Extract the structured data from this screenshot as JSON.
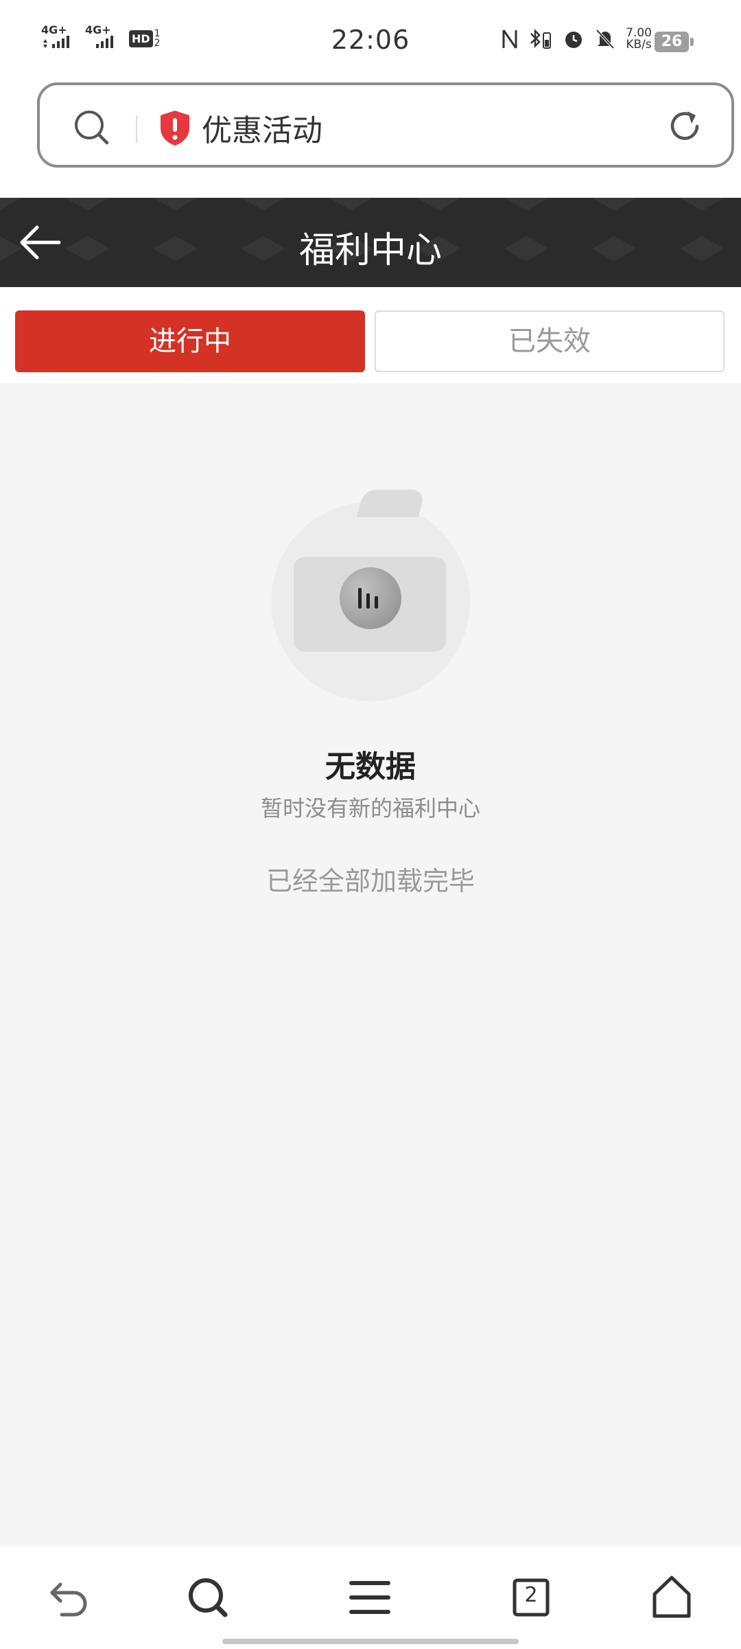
{
  "status_bar": {
    "time": "22:06",
    "signal1": "4G+",
    "signal2": "4G+",
    "hd": "HD",
    "net_speed_value": "7.00",
    "net_speed_unit": "KB/s",
    "battery": "26"
  },
  "address_bar": {
    "title": "优惠活动"
  },
  "header": {
    "title": "福利中心"
  },
  "tabs": [
    {
      "label": "进行中",
      "active": true
    },
    {
      "label": "已失效",
      "active": false
    }
  ],
  "empty_state": {
    "title": "无数据",
    "subtitle": "暂时没有新的福利中心"
  },
  "list_footer": {
    "text": "已经全部加载完毕"
  },
  "bottom_nav": {
    "tab_count": "2",
    "items": [
      "back-icon",
      "search-icon",
      "menu-icon",
      "tabs-icon",
      "home-icon"
    ]
  },
  "colors": {
    "accent": "#d43224",
    "header_bg": "#2b2b2b",
    "shield": "#e5393f"
  }
}
